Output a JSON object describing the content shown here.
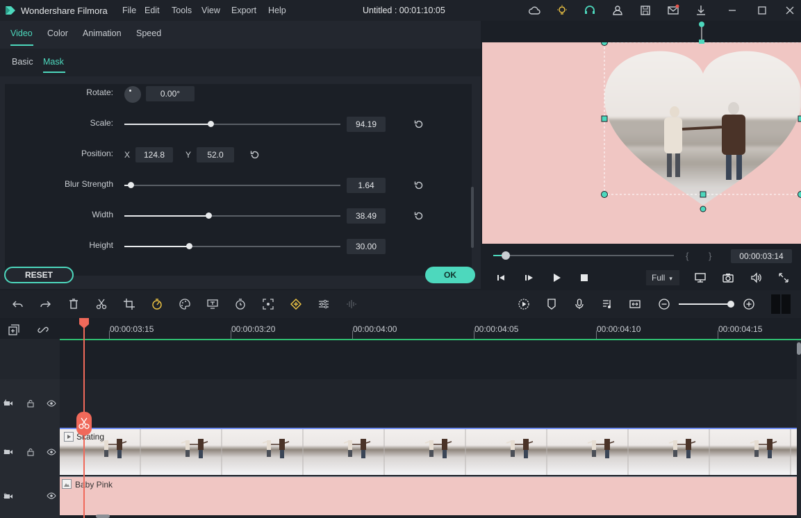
{
  "app": {
    "name": "Wondershare Filmora",
    "doc_title": "Untitled : 00:01:10:05",
    "menu": [
      "File",
      "Edit",
      "Tools",
      "View",
      "Export",
      "Help"
    ],
    "accent": "#4dd8bd"
  },
  "editor": {
    "tabs": [
      "Video",
      "Color",
      "Animation",
      "Speed"
    ],
    "subtabs": [
      "Basic",
      "Mask"
    ],
    "rotate": {
      "label": "Rotate:",
      "value": "0.00°"
    },
    "scale": {
      "label": "Scale:",
      "value": "94.19",
      "level": 0.4
    },
    "position": {
      "label": "Position:",
      "x_label": "X",
      "x_value": "124.8",
      "y_label": "Y",
      "y_value": "52.0"
    },
    "blur": {
      "label": "Blur Strength",
      "value": "1.64",
      "level": 0.03
    },
    "width": {
      "label": "Width",
      "value": "38.49",
      "level": 0.39
    },
    "height": {
      "label": "Height",
      "value": "30.00",
      "level": 0.3
    },
    "reset_label": "RESET",
    "ok_label": "OK"
  },
  "preview": {
    "timecode": "00:00:03:14",
    "quality": "Full",
    "bracket_in": "{",
    "bracket_out": "}",
    "playhead_level": 0.07
  },
  "timeline": {
    "ruler": [
      "00:00:03:15",
      "00:00:03:20",
      "00:00:04:00",
      "00:00:04:05",
      "00:00:04:10",
      "00:00:04:15"
    ],
    "tracks": [
      {
        "id": "4",
        "clip": ""
      },
      {
        "id": "3",
        "clip": "Skating"
      },
      {
        "id": "2",
        "clip": "Baby Pink"
      }
    ]
  }
}
